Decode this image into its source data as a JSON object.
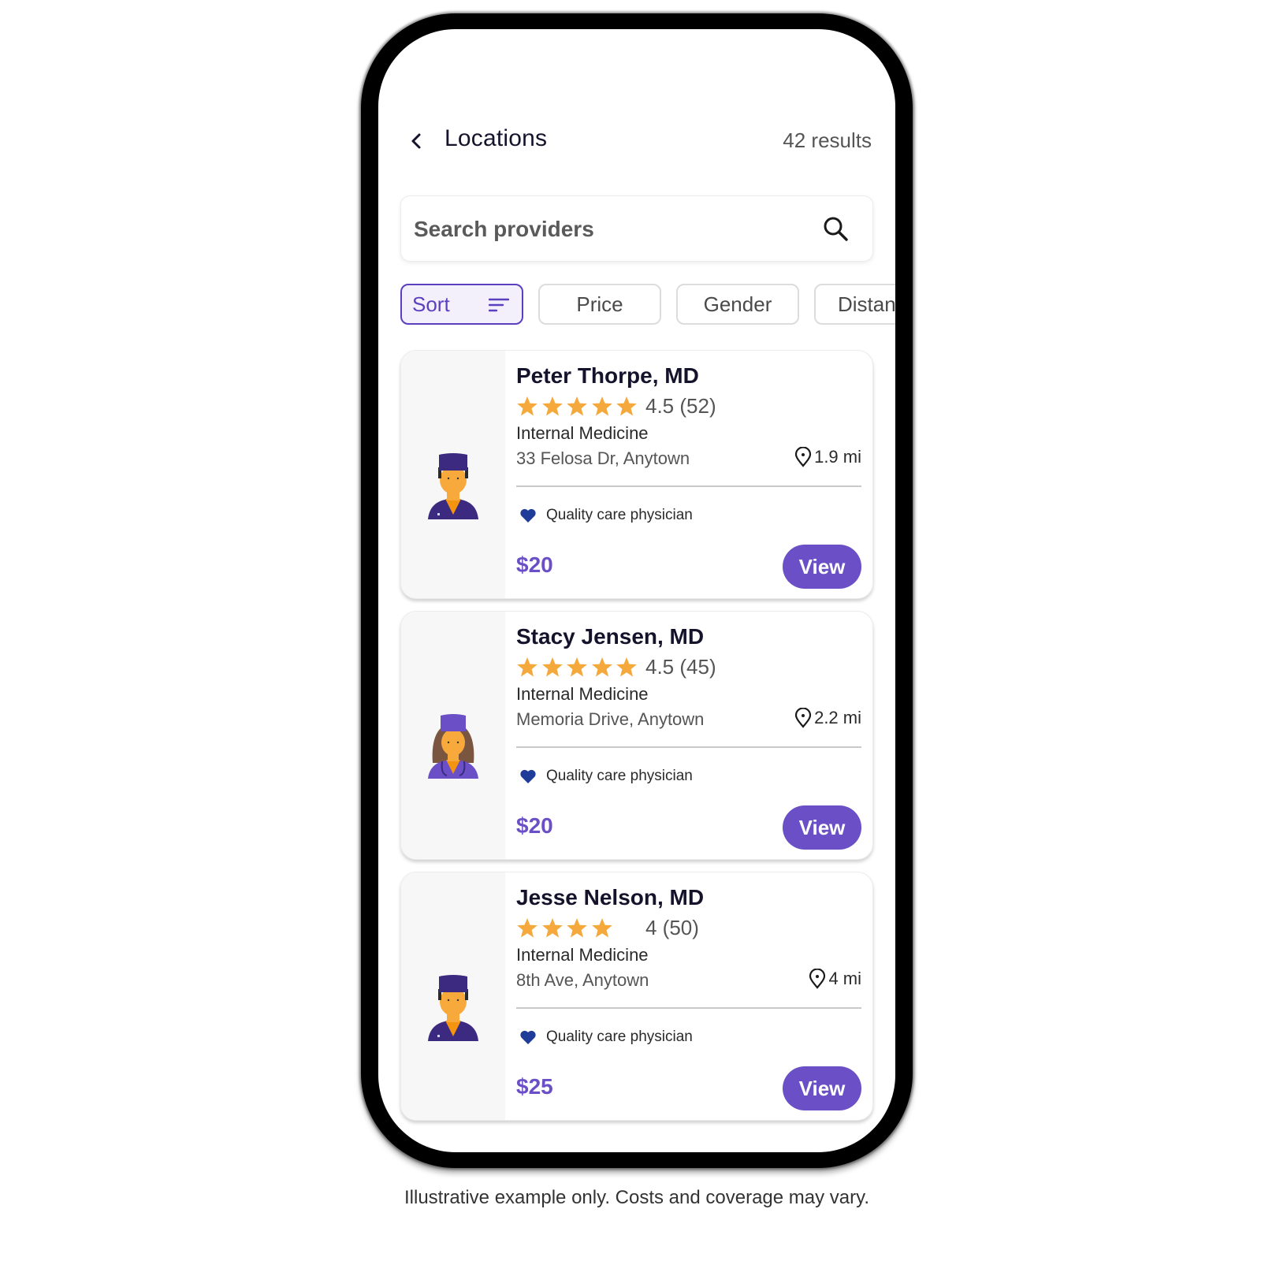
{
  "header": {
    "back_icon": "chevron-left-icon",
    "title": "Locations",
    "results": "42 results"
  },
  "search": {
    "placeholder": "Search providers",
    "value": "",
    "icon": "search-icon"
  },
  "filters": [
    {
      "label": "Sort",
      "active": true,
      "icon": "sort-icon"
    },
    {
      "label": "Price",
      "active": false
    },
    {
      "label": "Gender",
      "active": false
    },
    {
      "label": "Distan",
      "active": false
    }
  ],
  "providers": [
    {
      "name": "Peter Thorpe, MD",
      "rating": 4.5,
      "stars_shown": 5,
      "rating_text": "4.5 (52)",
      "specialty": "Internal Medicine",
      "address": "33 Felosa Dr, Anytown",
      "distance": "1.9 mi",
      "badge": "Quality care physician",
      "price": "$20",
      "view_label": "View",
      "avatar": "male-doctor-avatar"
    },
    {
      "name": "Stacy Jensen, MD",
      "rating": 4.5,
      "stars_shown": 5,
      "rating_text": "4.5 (45)",
      "specialty": "Internal Medicine",
      "address": "Memoria Drive, Anytown",
      "distance": "2.2 mi",
      "badge": "Quality care physician",
      "price": "$20",
      "view_label": "View",
      "avatar": "female-doctor-avatar"
    },
    {
      "name": "Jesse Nelson, MD",
      "rating": 4,
      "stars_shown": 4,
      "rating_text": "4 (50)",
      "specialty": "Internal Medicine",
      "address": "8th Ave, Anytown",
      "distance": "4 mi",
      "badge": "Quality care physician",
      "price": "$25",
      "view_label": "View",
      "avatar": "male-doctor-avatar"
    }
  ],
  "colors": {
    "accent": "#6a4fc6",
    "star": "#f5a93c",
    "heart": "#1f3c99"
  },
  "disclaimer": "Illustrative example only. Costs and coverage may vary."
}
